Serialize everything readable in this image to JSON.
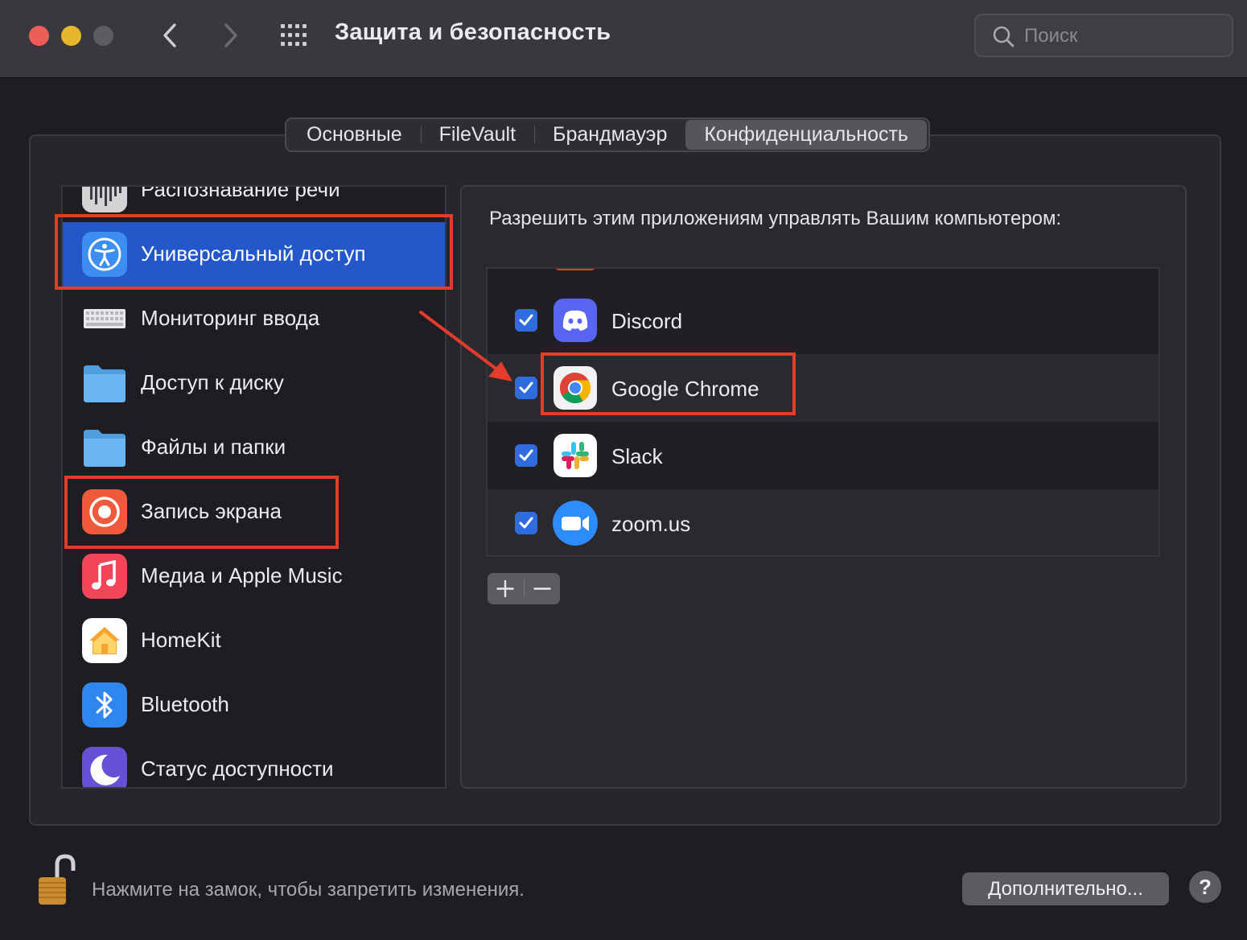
{
  "window": {
    "title": "Защита и безопасность",
    "search_placeholder": "Поиск"
  },
  "tabs": [
    {
      "label": "Основные",
      "active": false
    },
    {
      "label": "FileVault",
      "active": false
    },
    {
      "label": "Брандмауэр",
      "active": false
    },
    {
      "label": "Конфиденциальность",
      "active": true
    }
  ],
  "sidebar": {
    "items": [
      {
        "label": "Распознавание речи",
        "icon": "speech-recognition-icon"
      },
      {
        "label": "Универсальный доступ",
        "icon": "accessibility-icon",
        "selected": true
      },
      {
        "label": "Мониторинг ввода",
        "icon": "keyboard-icon"
      },
      {
        "label": "Доступ к диску",
        "icon": "folder-icon"
      },
      {
        "label": "Файлы и папки",
        "icon": "folder-icon"
      },
      {
        "label": "Запись экрана",
        "icon": "screen-recording-icon"
      },
      {
        "label": "Медиа и Apple Music",
        "icon": "music-note-icon"
      },
      {
        "label": "HomeKit",
        "icon": "home-icon"
      },
      {
        "label": "Bluetooth",
        "icon": "bluetooth-icon"
      },
      {
        "label": "Статус доступности",
        "icon": "moon-icon"
      }
    ]
  },
  "main": {
    "heading": "Разрешить этим приложениям управлять Вашим компьютером:",
    "apps": [
      {
        "name": "Discord",
        "checked": true,
        "icon": "discord-icon"
      },
      {
        "name": "Google Chrome",
        "checked": true,
        "icon": "chrome-icon"
      },
      {
        "name": "Slack",
        "checked": true,
        "icon": "slack-icon"
      },
      {
        "name": "zoom.us",
        "checked": true,
        "icon": "zoom-icon"
      }
    ],
    "add_label": "+",
    "remove_label": "—"
  },
  "footer": {
    "lock_text": "Нажмите на замок, чтобы запретить изменения.",
    "advanced_label": "Дополнительно...",
    "help_label": "?"
  },
  "colors": {
    "selection": "#2457c9",
    "checkbox": "#2f6ce0",
    "annotation": "#e43b2c"
  }
}
